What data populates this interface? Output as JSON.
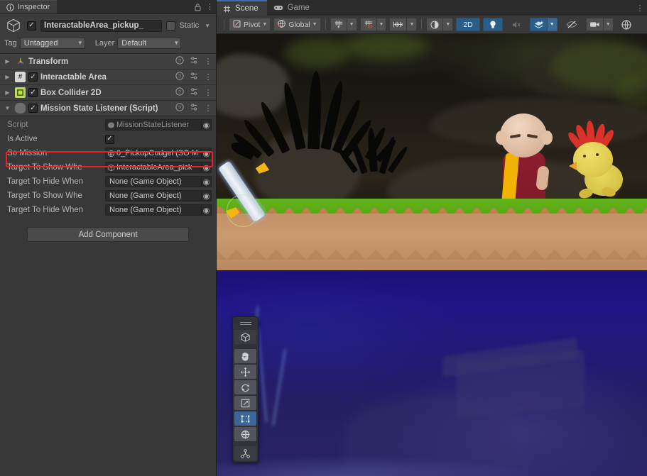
{
  "inspector": {
    "tab": {
      "label": "Inspector",
      "icon": "info-icon"
    },
    "lock_icon": "lock-icon",
    "menu_icon": "kebab-menu-icon",
    "object": {
      "icon": "gameobject-cube-icon",
      "enabled": true,
      "name": "InteractableArea_pickup_",
      "static_checkbox": false,
      "static_label": "Static",
      "tag_label": "Tag",
      "tag_value": "Untagged",
      "layer_label": "Layer",
      "layer_value": "Default"
    },
    "components": [
      {
        "name": "Transform",
        "icon": "transform-axis-icon",
        "expanded": false,
        "has_enable_toggle": false,
        "enabled": true
      },
      {
        "name": "Interactable Area",
        "icon": "script-hash-icon",
        "expanded": false,
        "has_enable_toggle": true,
        "enabled": true
      },
      {
        "name": "Box Collider 2D",
        "icon": "box-collider-2d-icon",
        "expanded": false,
        "has_enable_toggle": true,
        "enabled": true
      },
      {
        "name": "Mission State Listener (Script)",
        "icon": "script-capsule-icon",
        "expanded": true,
        "has_enable_toggle": true,
        "enabled": true
      }
    ],
    "component_row_actions": {
      "help": "help-icon",
      "preset": "preset-icon",
      "menu": "kebab-menu-icon"
    },
    "properties": [
      {
        "label": "Script",
        "type": "object",
        "value": "MissionStateListener",
        "icon": "script-capsule-icon",
        "dimmed": true
      },
      {
        "label": "Is Active",
        "type": "bool",
        "value": true
      },
      {
        "label": "So Mission",
        "type": "object",
        "value": "0_PickupCudgel (SO M",
        "icon": "scriptable-object-icon",
        "highlighted": true
      },
      {
        "label": "Target To Show Whe",
        "type": "object",
        "value": "InteractableArea_pick",
        "icon": "gameobject-cube-icon"
      },
      {
        "label": "Target To Hide When",
        "type": "object",
        "value": "None (Game Object)"
      },
      {
        "label": "Target To Show Whe",
        "type": "object",
        "value": "None (Game Object)"
      },
      {
        "label": "Target To Hide When",
        "type": "object",
        "value": "None (Game Object)"
      }
    ],
    "add_component_label": "Add Component",
    "highlight_color": "#ec2227"
  },
  "scene_panel": {
    "tabs": [
      {
        "label": "Scene",
        "icon": "grid-hash-icon",
        "active": true
      },
      {
        "label": "Game",
        "icon": "gamepad-icon",
        "active": false
      }
    ],
    "menu_icon": "kebab-menu-icon",
    "toolbar": {
      "pivot": {
        "label": "Pivot",
        "icon": "pivot-icon",
        "caret": "▾"
      },
      "handle": {
        "label": "Global",
        "icon": "globe-icon",
        "caret": "▾"
      },
      "grid_visibility": {
        "icon": "grid-visibility-icon",
        "caret": "▾"
      },
      "grid_snap": {
        "icon": "grid-snap-icon",
        "caret": "▾"
      },
      "snap_increment": {
        "icon": "snap-increment-icon",
        "caret": "▾"
      },
      "scene_lighting_mode": {
        "icon": "shading-sphere-icon",
        "caret": "▾"
      },
      "view_2d": {
        "label": "2D",
        "active": true
      },
      "lighting": {
        "icon": "lightbulb-icon",
        "active": true
      },
      "audio": {
        "icon": "audio-mute-icon",
        "active": false
      },
      "fx": {
        "icon": "fx-layers-icon",
        "active": true,
        "caret": "▾"
      },
      "hidden_objects": {
        "icon": "eye-off-icon",
        "active": false
      },
      "camera": {
        "icon": "camera-icon",
        "caret": "▾"
      },
      "gizmos": {
        "icon": "gizmos-globe-icon",
        "active": false
      }
    },
    "tools_overlay": {
      "handle": "drag-handle-icon",
      "tools": [
        {
          "icon": "default-cube-tool-icon",
          "active": false,
          "style": "dark"
        },
        {
          "icon": "hand-pan-tool-icon",
          "active": false,
          "style": "light"
        },
        {
          "icon": "move-tool-icon",
          "active": false,
          "style": "light"
        },
        {
          "icon": "rotate-tool-icon",
          "active": false,
          "style": "light"
        },
        {
          "icon": "scale-tool-icon",
          "active": false,
          "style": "light"
        },
        {
          "icon": "rect-transform-tool-icon",
          "active": true,
          "style": "light"
        },
        {
          "icon": "transform-tool-icon",
          "active": false,
          "style": "light"
        },
        {
          "icon": "custom-editor-tool-icon",
          "active": false,
          "style": "dark"
        }
      ]
    },
    "viewport": {
      "objects": [
        {
          "name": "monk-character",
          "kind": "character"
        },
        {
          "name": "chicken-character",
          "kind": "character"
        },
        {
          "name": "cudgel-pickup",
          "kind": "pickup-item"
        }
      ],
      "colors": {
        "grass": "#63b21a",
        "dirt": "#c59267",
        "water": "#201585",
        "cave": "#1a1813"
      }
    }
  }
}
